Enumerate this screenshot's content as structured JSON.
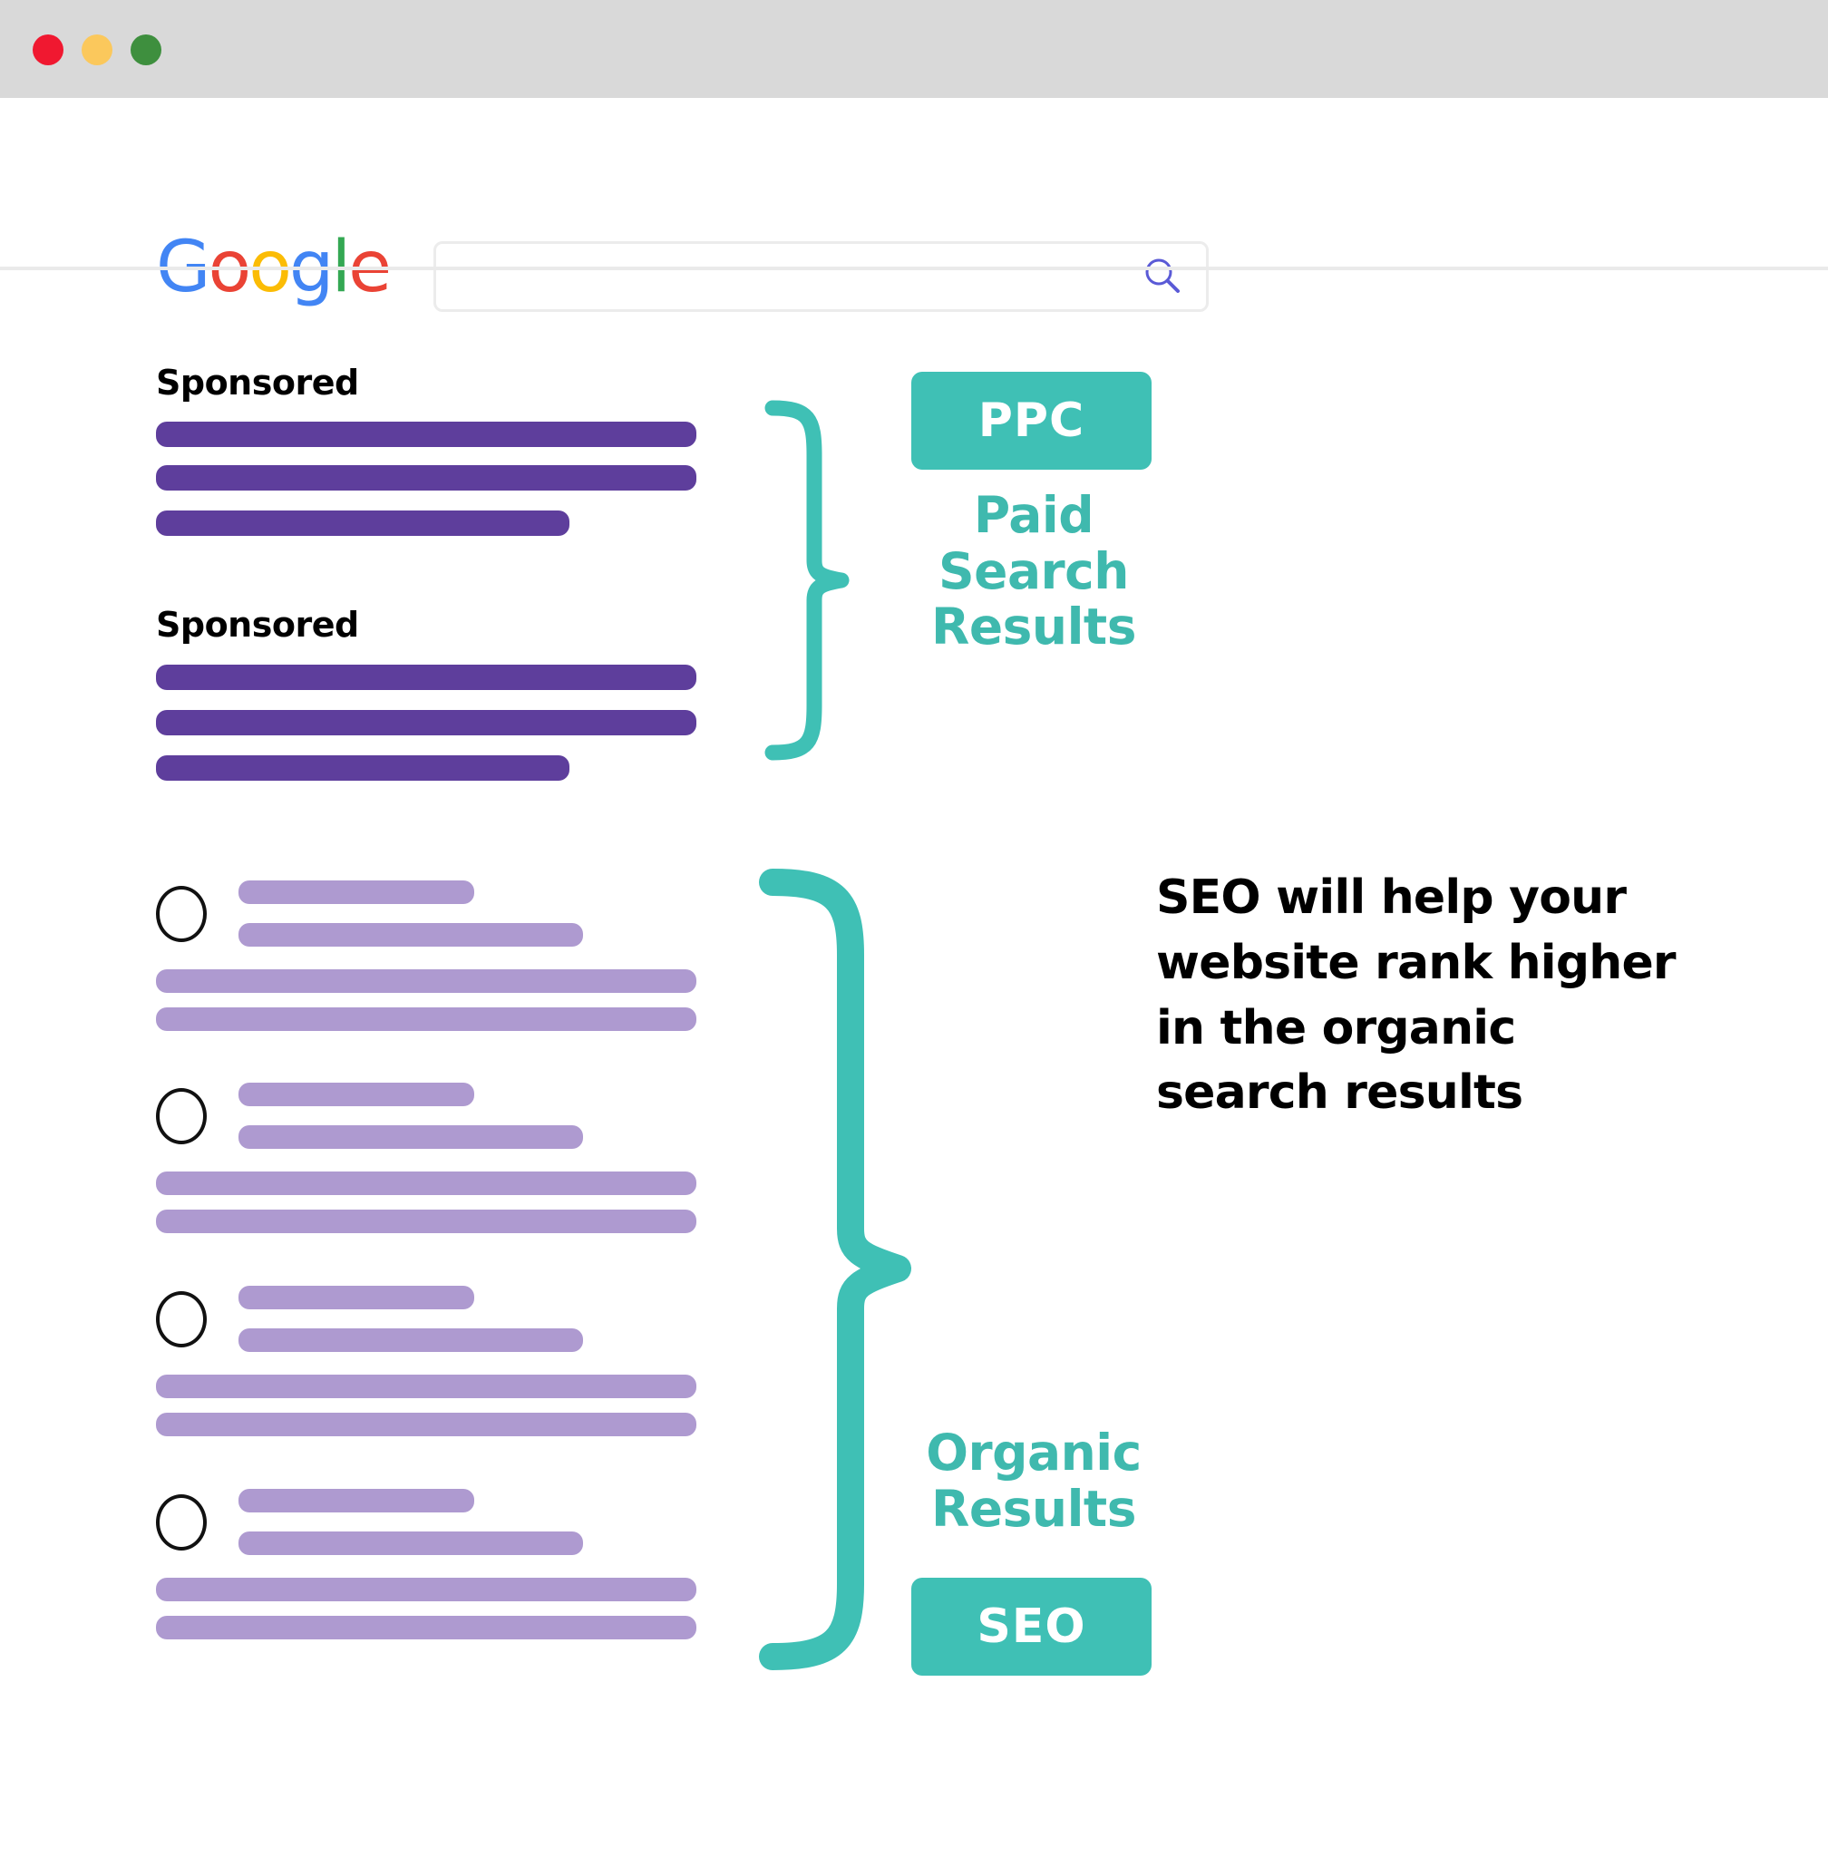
{
  "window": {
    "traffic_lights": [
      {
        "name": "close",
        "color": "#f01830"
      },
      {
        "name": "minimize",
        "color": "#fbc85c"
      },
      {
        "name": "zoom",
        "color": "#3e8f3e"
      }
    ]
  },
  "header": {
    "logo": {
      "name": "google-logo",
      "letters": [
        "G",
        "o",
        "o",
        "g",
        "l",
        "e"
      ],
      "colors": [
        "#4285f4",
        "#ea4335",
        "#fbbc05",
        "#4285f4",
        "#34a853",
        "#ea4335"
      ]
    },
    "search": {
      "value": "",
      "placeholder": "",
      "icon": "search-icon",
      "icon_color": "#5a5ad6"
    }
  },
  "results": {
    "sponsored_label": "Sponsored",
    "paid_blocks": [
      {
        "label": "Sponsored",
        "bar_widths": [
          596,
          596,
          456
        ]
      },
      {
        "label": "Sponsored",
        "bar_widths": [
          596,
          596,
          456
        ]
      }
    ],
    "organic_blocks": [
      {
        "title_width": 260,
        "url_width": 380,
        "body_widths": [
          596,
          596
        ]
      },
      {
        "title_width": 260,
        "url_width": 380,
        "body_widths": [
          596,
          596
        ]
      },
      {
        "title_width": 260,
        "url_width": 380,
        "body_widths": [
          596,
          596
        ]
      },
      {
        "title_width": 260,
        "url_width": 380,
        "body_widths": [
          596,
          596
        ]
      }
    ]
  },
  "colors": {
    "teal": "#3fc0b5",
    "teal_text": "#3fb9ae",
    "purple_dark": "#5e3e9c",
    "purple_light": "#ae9ad0",
    "titlebar": "#d9d9d9",
    "divider": "#eaeaea"
  },
  "callouts": {
    "ppc": {
      "badge": "PPC",
      "caption_lines": [
        "Paid",
        "Search",
        "Results"
      ]
    },
    "seo": {
      "badge": "SEO",
      "caption_lines": [
        "Organic",
        "Results"
      ]
    }
  },
  "annotation": {
    "seo_paragraph": "SEO will help your website rank higher in the organic search results"
  }
}
